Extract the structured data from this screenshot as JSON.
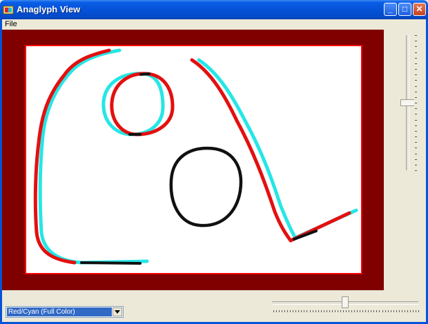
{
  "window": {
    "title": "Anaglyph View",
    "buttons": {
      "minimize": "_",
      "maximize": "□",
      "close": "✕"
    }
  },
  "menu": {
    "file": "File"
  },
  "canvas": {
    "colors": {
      "frame": "#800000",
      "border": "#ff0000",
      "left_eye": "#e31010",
      "right_eye": "#26e6e6",
      "overlap": "#111111"
    }
  },
  "sliders": {
    "vertical_level": 0.5,
    "horizontal_level": 0.5
  },
  "mode_select": {
    "value": "Red/Cyan (Full Color)"
  },
  "icons": {
    "app": "anaglyph-app-icon",
    "dropdown": "chevron-down-icon"
  }
}
